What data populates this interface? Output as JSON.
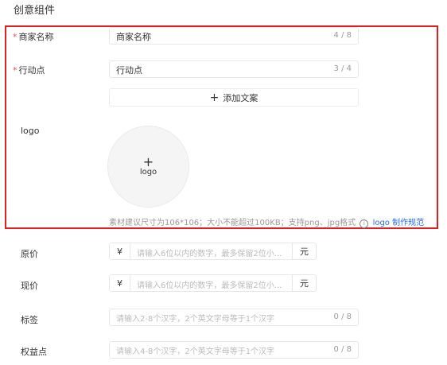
{
  "section_title": "创意组件",
  "merchant_name": {
    "label": "商家名称",
    "value": "商家名称",
    "count": "4 / 8"
  },
  "action_point": {
    "label": "行动点",
    "value": "行动点",
    "count": "3 / 4"
  },
  "add_copy_button": "添加文案",
  "logo": {
    "label": "logo",
    "upload_label": "logo"
  },
  "hint": {
    "text": "素材建议尺寸为106*106；大小不能超过100KB；支持png、jpg格式",
    "info_icon": "i",
    "link": "logo 制作规范"
  },
  "original_price": {
    "label": "原价",
    "prefix": "¥",
    "placeholder": "请输入6位以内的数字，最多保留2位小...",
    "suffix": "元"
  },
  "current_price": {
    "label": "现价",
    "prefix": "¥",
    "placeholder": "请输入6位以内的数字，最多保留2位小...",
    "suffix": "元"
  },
  "tag": {
    "label": "标签",
    "placeholder": "请输入2-8个汉字，2个英文字母等于1个汉字",
    "count": "0 / 8"
  },
  "benefit_point": {
    "label": "权益点",
    "placeholder": "请输入4-8个汉字，2个英文字母等于1个汉字",
    "count": "0 / 8"
  },
  "colors": {
    "highlight_border": "#e02020",
    "required": "#e34d59",
    "link": "#2a6ef5"
  }
}
